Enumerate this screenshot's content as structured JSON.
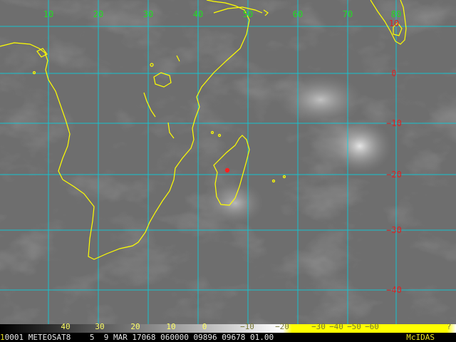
{
  "map": {
    "top_longitude_labels": [
      "10",
      "20",
      "30",
      "40",
      "50",
      "60",
      "70",
      "80"
    ],
    "right_latitude_labels": [
      "10",
      "0",
      "−10",
      "−20",
      "−30",
      "−40"
    ],
    "colors": {
      "background": "#6f6f6f",
      "grid": "#00d8e8",
      "coast": "#ffff00",
      "lon_label": "#22dd22",
      "lat_label": "#e02020",
      "hotspot": "#ff2020"
    }
  },
  "colorbar": {
    "tick_labels": [
      "40",
      "30",
      "20",
      "10",
      "0",
      "−10",
      "−20",
      "−30",
      "−40",
      "−50",
      "−60"
    ],
    "end_label": "?"
  },
  "status_bar": {
    "frame_index": "1",
    "text": "0001 METEOSAT8    5  9 MAR 17068 060000 09896 09678 01.00",
    "brand": "McIDAS"
  }
}
